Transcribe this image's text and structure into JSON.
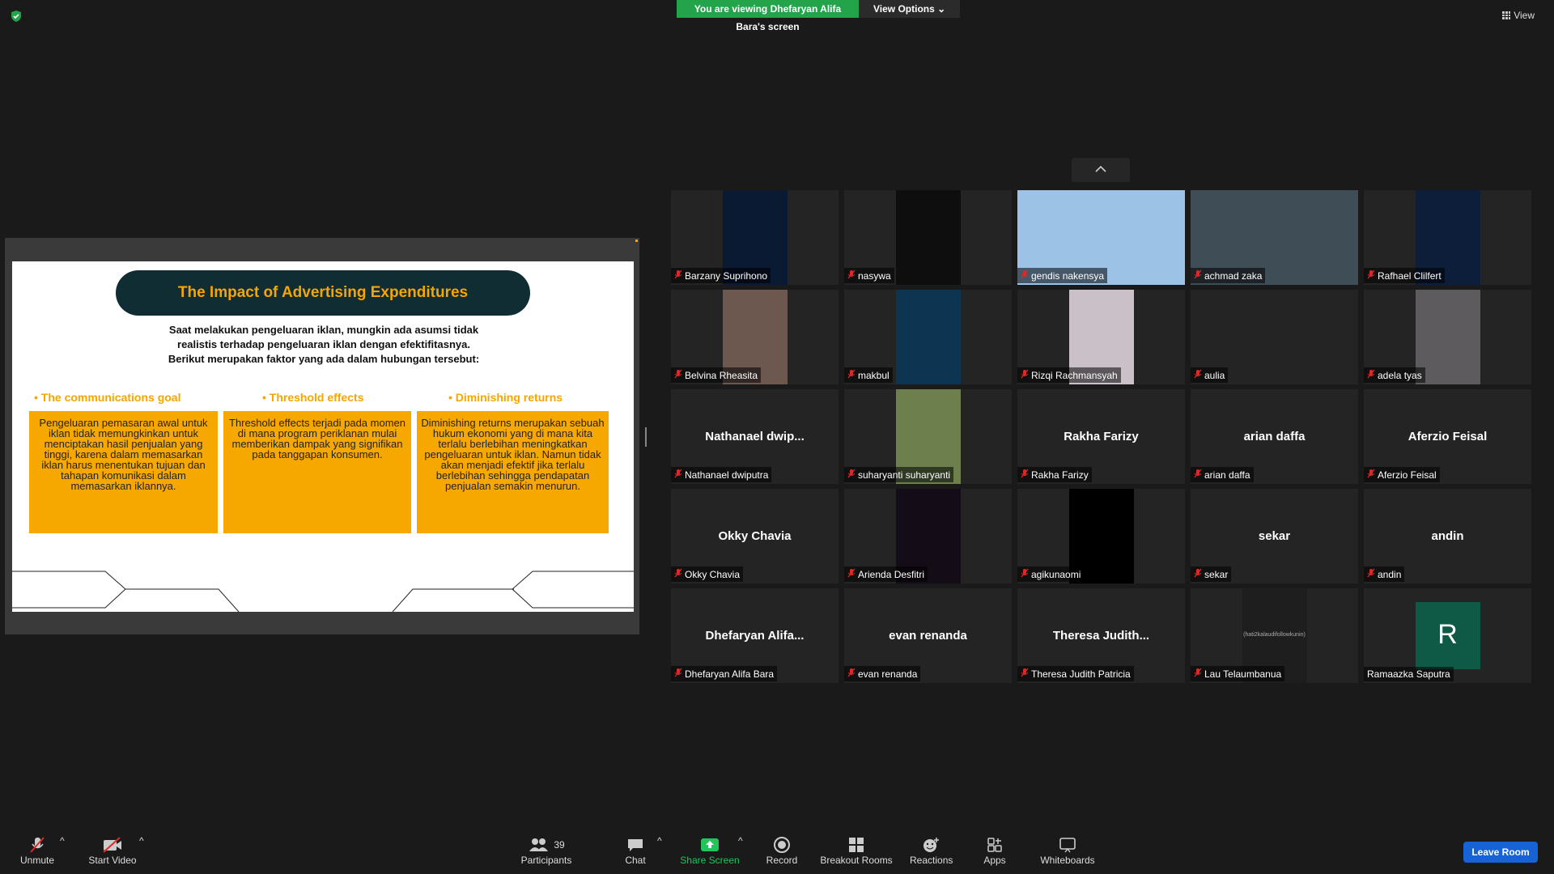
{
  "banner": {
    "viewing": "You are viewing Dhefaryan Alifa Bara's screen",
    "options": "View Options"
  },
  "view": "View",
  "slide": {
    "title": "The Impact of Advertising Expenditures",
    "intro": "Saat melakukan pengeluaran iklan, mungkin ada asumsi tidak realistis terhadap pengeluaran iklan dengan efektifitasnya. Berikut merupakan faktor yang ada dalam hubungan tersebut:",
    "columns": [
      {
        "head": "• The communications goal",
        "body": "Pengeluaran pemasaran awal untuk iklan tidak memungkinkan untuk menciptakan hasil penjualan yang tinggi, karena dalam memasarkan iklan harus menentukan tujuan dan tahapan komunikasi dalam memasarkan iklannya."
      },
      {
        "head": "• Threshold effects",
        "body": "Threshold effects terjadi pada momen di mana program periklanan mulai memberikan dampak yang signifikan pada tanggapan konsumen."
      },
      {
        "head": "• Diminishing returns",
        "body": "Diminishing returns merupakan sebuah hukum ekonomi yang di mana kita terlalu berlebihan meningkatkan pengeluaran untuk iklan. Namun  tidak akan menjadi efektif jika terlalu berlebihan sehingga pendapatan penjualan semakin menurun."
      }
    ]
  },
  "participants": [
    {
      "name": "Barzany Suprihono",
      "center": "",
      "bg": "#0b1a33"
    },
    {
      "name": "nasywa",
      "center": "",
      "bg": "#0e0e0e"
    },
    {
      "name": "gendis nakensya",
      "center": "",
      "bg": "#9cc3e6"
    },
    {
      "name": "achmad zaka",
      "center": "",
      "bg": "#3e4d56"
    },
    {
      "name": "Rafhael Clilfert",
      "center": "",
      "bg": "#0d1e3a"
    },
    {
      "name": "Belvina Rheasita",
      "center": "",
      "bg": "#6d5850"
    },
    {
      "name": "makbul",
      "center": "",
      "bg": "#0d3450"
    },
    {
      "name": "Rizqi Rachmansyah",
      "center": "",
      "bg": "#c9c0c8"
    },
    {
      "name": "aulia",
      "center": "",
      "bg": ""
    },
    {
      "name": "adela tyas",
      "center": "",
      "bg": "#5d5b5d"
    },
    {
      "name": "Nathanael dwiputra",
      "center": "Nathanael  dwip...",
      "bg": ""
    },
    {
      "name": "suharyanti suharyanti",
      "center": "",
      "bg": "#6c7f4c"
    },
    {
      "name": "Rakha Farizy",
      "center": "Rakha Farizy",
      "bg": ""
    },
    {
      "name": "arian daffa",
      "center": "arian daffa",
      "bg": ""
    },
    {
      "name": "Aferzio Feisal",
      "center": "Aferzio Feisal",
      "bg": ""
    },
    {
      "name": "Okky Chavia",
      "center": "Okky Chavia",
      "bg": ""
    },
    {
      "name": "Arienda Desfitri",
      "center": "",
      "bg": "#140d18"
    },
    {
      "name": "agikunaomi",
      "center": "",
      "bg": "#000000"
    },
    {
      "name": "sekar",
      "center": "sekar",
      "bg": ""
    },
    {
      "name": "andin",
      "center": "andin",
      "bg": ""
    },
    {
      "name": "Dhefaryan Alifa Bara",
      "center": "Dhefaryan  Alifa...",
      "bg": ""
    },
    {
      "name": "evan renanda",
      "center": "evan renanda",
      "bg": ""
    },
    {
      "name": "Theresa Judith Patricia",
      "center": "Theresa  Judith...",
      "bg": ""
    },
    {
      "name": "Lau Telaumbanua",
      "center": "(hati2kalaudifollowkunin)",
      "bg": "#1e1e1e"
    },
    {
      "name": "Ramaazka Saputra",
      "center": "R",
      "bg": "#0e5a47"
    }
  ],
  "toolbar": {
    "unmute": "Unmute",
    "start_video": "Start Video",
    "participants": "Participants",
    "participants_count": "39",
    "chat": "Chat",
    "share_screen": "Share Screen",
    "record": "Record",
    "breakout": "Breakout Rooms",
    "reactions": "Reactions",
    "apps": "Apps",
    "whiteboards": "Whiteboards",
    "leave": "Leave Room"
  }
}
